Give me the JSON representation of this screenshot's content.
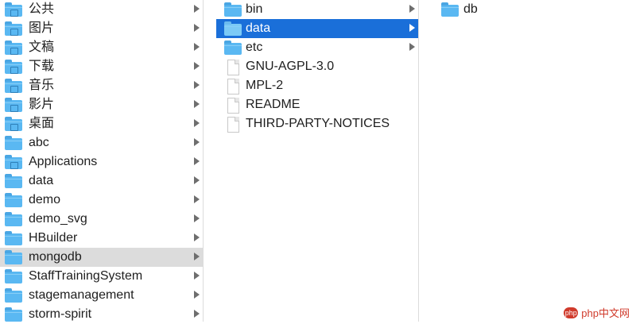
{
  "column1": {
    "items": [
      {
        "label": "公共",
        "icon": "public-folder-icon",
        "arrow": true
      },
      {
        "label": "图片",
        "icon": "pictures-folder-icon",
        "arrow": true
      },
      {
        "label": "文稿",
        "icon": "documents-folder-icon",
        "arrow": true
      },
      {
        "label": "下载",
        "icon": "downloads-folder-icon",
        "arrow": true
      },
      {
        "label": "音乐",
        "icon": "music-folder-icon",
        "arrow": true
      },
      {
        "label": "影片",
        "icon": "movies-folder-icon",
        "arrow": true
      },
      {
        "label": "桌面",
        "icon": "desktop-folder-icon",
        "arrow": true
      },
      {
        "label": "abc",
        "icon": "folder-icon",
        "arrow": true
      },
      {
        "label": "Applications",
        "icon": "applications-folder-icon",
        "arrow": true
      },
      {
        "label": "data",
        "icon": "folder-icon",
        "arrow": true
      },
      {
        "label": "demo",
        "icon": "folder-icon",
        "arrow": true
      },
      {
        "label": "demo_svg",
        "icon": "folder-icon",
        "arrow": true
      },
      {
        "label": "HBuilder",
        "icon": "folder-icon",
        "arrow": true
      },
      {
        "label": "mongodb",
        "icon": "folder-icon",
        "arrow": true,
        "selected": "inactive"
      },
      {
        "label": "StaffTrainingSystem",
        "icon": "folder-icon",
        "arrow": true
      },
      {
        "label": "stagemanagement",
        "icon": "folder-icon",
        "arrow": true
      },
      {
        "label": "storm-spirit",
        "icon": "folder-icon",
        "arrow": true
      }
    ]
  },
  "column2": {
    "items": [
      {
        "label": "bin",
        "icon": "folder-icon",
        "arrow": true
      },
      {
        "label": "data",
        "icon": "folder-icon",
        "arrow": true,
        "selected": "active"
      },
      {
        "label": "etc",
        "icon": "folder-icon",
        "arrow": true
      },
      {
        "label": "GNU-AGPL-3.0",
        "icon": "document-icon",
        "arrow": false
      },
      {
        "label": "MPL-2",
        "icon": "document-icon",
        "arrow": false
      },
      {
        "label": "README",
        "icon": "document-icon",
        "arrow": false
      },
      {
        "label": "THIRD-PARTY-NOTICES",
        "icon": "document-icon",
        "arrow": false
      }
    ]
  },
  "column3": {
    "items": [
      {
        "label": "db",
        "icon": "folder-icon",
        "arrow": false
      }
    ]
  },
  "watermark": {
    "text": "php中文网"
  },
  "colors": {
    "selection_active": "#1a6fd9",
    "selection_inactive": "#dcdcdc",
    "folder": "#5ab8f2"
  }
}
